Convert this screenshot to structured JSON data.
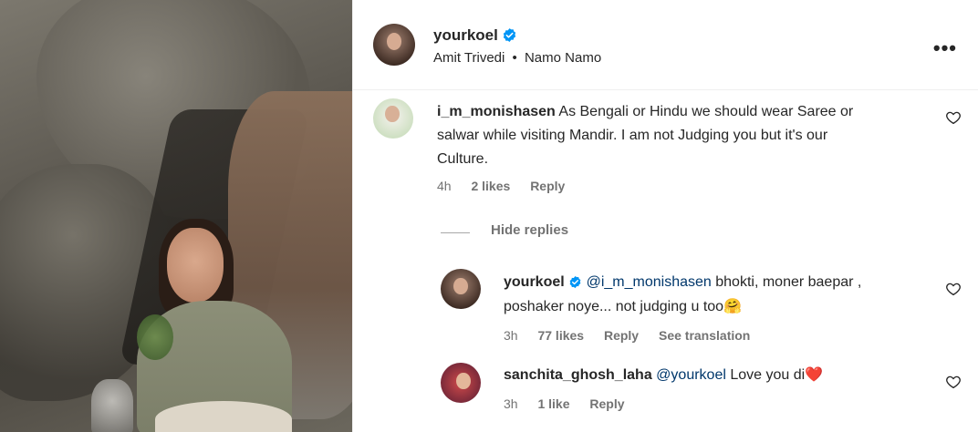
{
  "post": {
    "author": "yourkoel",
    "audio_artist": "Amit Trivedi",
    "separator": "•",
    "audio_track": "Namo Namo",
    "more_label": "•••"
  },
  "comments": [
    {
      "username": "i_m_monishasen",
      "text": "As Bengali or Hindu we should wear Saree or salwar while visiting Mandir. I am not Judging you but it's our Culture.",
      "text_lines": [
        "As Bengali or Hindu we should wear Saree or",
        "salwar while visiting Mandir. I am not Judging you but it's our",
        "Culture."
      ],
      "time": "4h",
      "likes": "2 likes",
      "reply": "Reply",
      "hide_replies": "Hide replies"
    }
  ],
  "replies": [
    {
      "username": "yourkoel",
      "mention": "@i_m_monishasen",
      "text": "bhokti, moner baepar ,",
      "text_line2": "poshaker noye... not judging u too",
      "emoji": "🤗",
      "time": "3h",
      "likes": "77 likes",
      "reply": "Reply",
      "translate": "See translation"
    },
    {
      "username": "sanchita_ghosh_laha",
      "mention": "@yourkoel",
      "text": "Love you di",
      "emoji": "❤️",
      "time": "3h",
      "likes": "1 like",
      "reply": "Reply"
    }
  ],
  "colors": {
    "verified": "#0095f6",
    "mention": "#00376b",
    "muted": "#737373",
    "heart_emoji": "#ed4956"
  },
  "icons": {
    "verified": "verified-badge-icon",
    "heart": "heart-outline-icon",
    "more": "more-horizontal-icon"
  }
}
